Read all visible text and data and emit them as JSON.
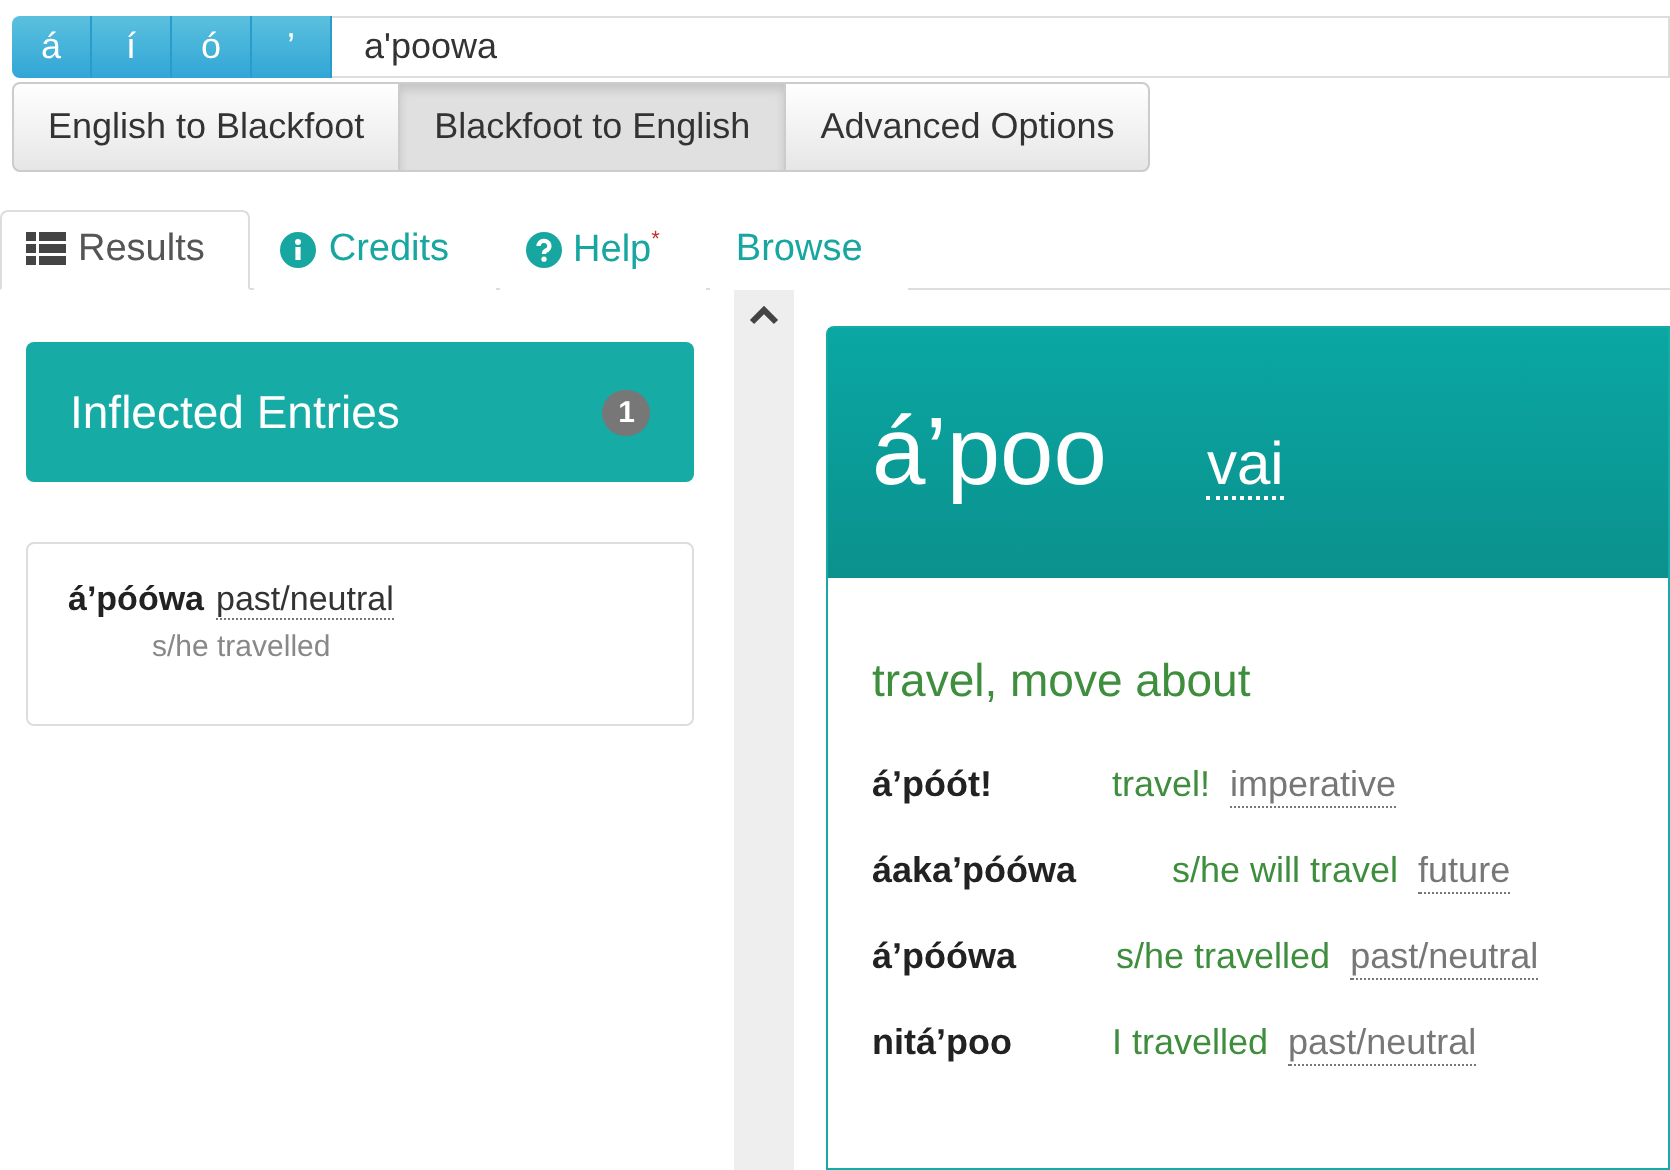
{
  "accent_keys": [
    "á",
    "í",
    "ó",
    "’"
  ],
  "search": {
    "value": "a'poowa"
  },
  "modes": [
    {
      "label": "English to Blackfoot",
      "selected": false
    },
    {
      "label": "Blackfoot to English",
      "selected": true
    },
    {
      "label": "Advanced Options",
      "selected": false
    }
  ],
  "tabs": [
    {
      "label": "Results",
      "kind": "list",
      "selected": true
    },
    {
      "label": "Credits",
      "kind": "info",
      "selected": false
    },
    {
      "label": "Help$^{*}$",
      "kind": "help",
      "selected": false
    },
    {
      "label": "Browse",
      "kind": "plain",
      "selected": false
    }
  ],
  "sidebar": {
    "title": "Inflected Entries",
    "count": "1",
    "entries": [
      {
        "word": "á’póówa",
        "tag": "past/neutral",
        "gloss": "s/he travelled"
      }
    ]
  },
  "entry": {
    "headword": "á’poo",
    "pos": "vai",
    "definition": "travel, move about",
    "forms": [
      {
        "word": "á’póót!",
        "gloss": "travel!",
        "tag": "imperative"
      },
      {
        "word": "áaka’póówa",
        "gloss": "s/he will travel",
        "tag": "future"
      },
      {
        "word": "á’póówa",
        "gloss": "s/he travelled",
        "tag": "past/neutral"
      },
      {
        "word": "nitá’poo",
        "gloss": "I travelled",
        "tag": "past/neutral"
      }
    ]
  }
}
